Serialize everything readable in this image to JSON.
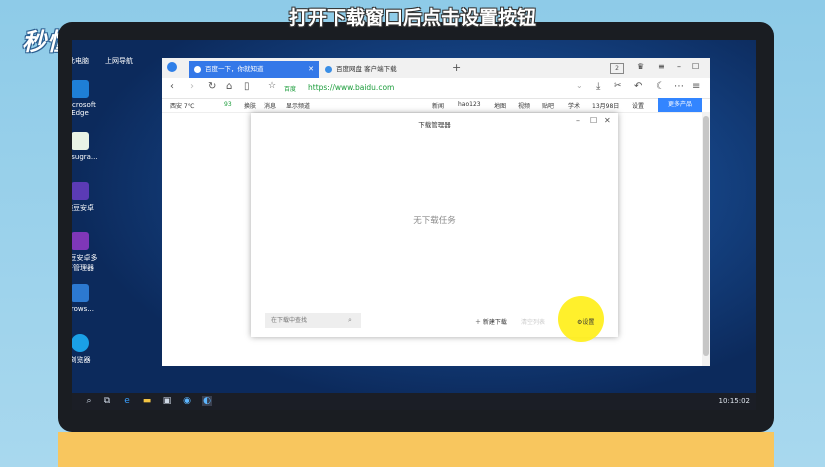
{
  "watermark": "秒懂视频",
  "desktop": {
    "top_labels": [
      "此电脑",
      "上网导航"
    ],
    "icons": [
      {
        "label": "Microsoft Edge",
        "icon": "edge-icon",
        "color": "#1e7fd6"
      },
      {
        "label": "Resugra...",
        "icon": "apk-file-icon",
        "color": "#e9f3e6"
      },
      {
        "label": "豌豆安卓",
        "icon": "app-gem-icon",
        "color": "#5b3bb5"
      },
      {
        "label": "豌豆安卓多开管理器",
        "icon": "app-gem-multi-icon",
        "color": "#7f37b8"
      },
      {
        "label": "Brows...",
        "icon": "browser-shortcut-icon",
        "color": "#2c79d0"
      },
      {
        "label": "浏览器",
        "icon": "browser-icon",
        "color": "#1aa0e6"
      }
    ]
  },
  "browser": {
    "tabs": [
      {
        "title": "百度一下，你就知道",
        "active": true
      },
      {
        "title": "百度网盘 客户端下载",
        "active": false
      }
    ],
    "new_tab": "+",
    "tab_count": "2",
    "url_prefix": "百度",
    "url": "https://www.baidu.com",
    "weather": "西安 7℃",
    "aqi": "93",
    "bookmarks_left": [
      "换肤",
      "消息",
      "显示频道"
    ],
    "bookmarks_right": [
      "新闻",
      "hao123",
      "地图",
      "视频",
      "贴吧",
      "学术",
      "13月98日",
      "设置"
    ],
    "more_products": "更多产品"
  },
  "download_manager": {
    "title": "下载管理器",
    "empty_text": "无下载任务",
    "search_placeholder": "在下载中查找",
    "new_download": "新建下载",
    "clear": "清空列表",
    "settings": "设置"
  },
  "taskbar": {
    "time": "10:15:02"
  },
  "caption": "打开下载窗口后点击设置按钮"
}
